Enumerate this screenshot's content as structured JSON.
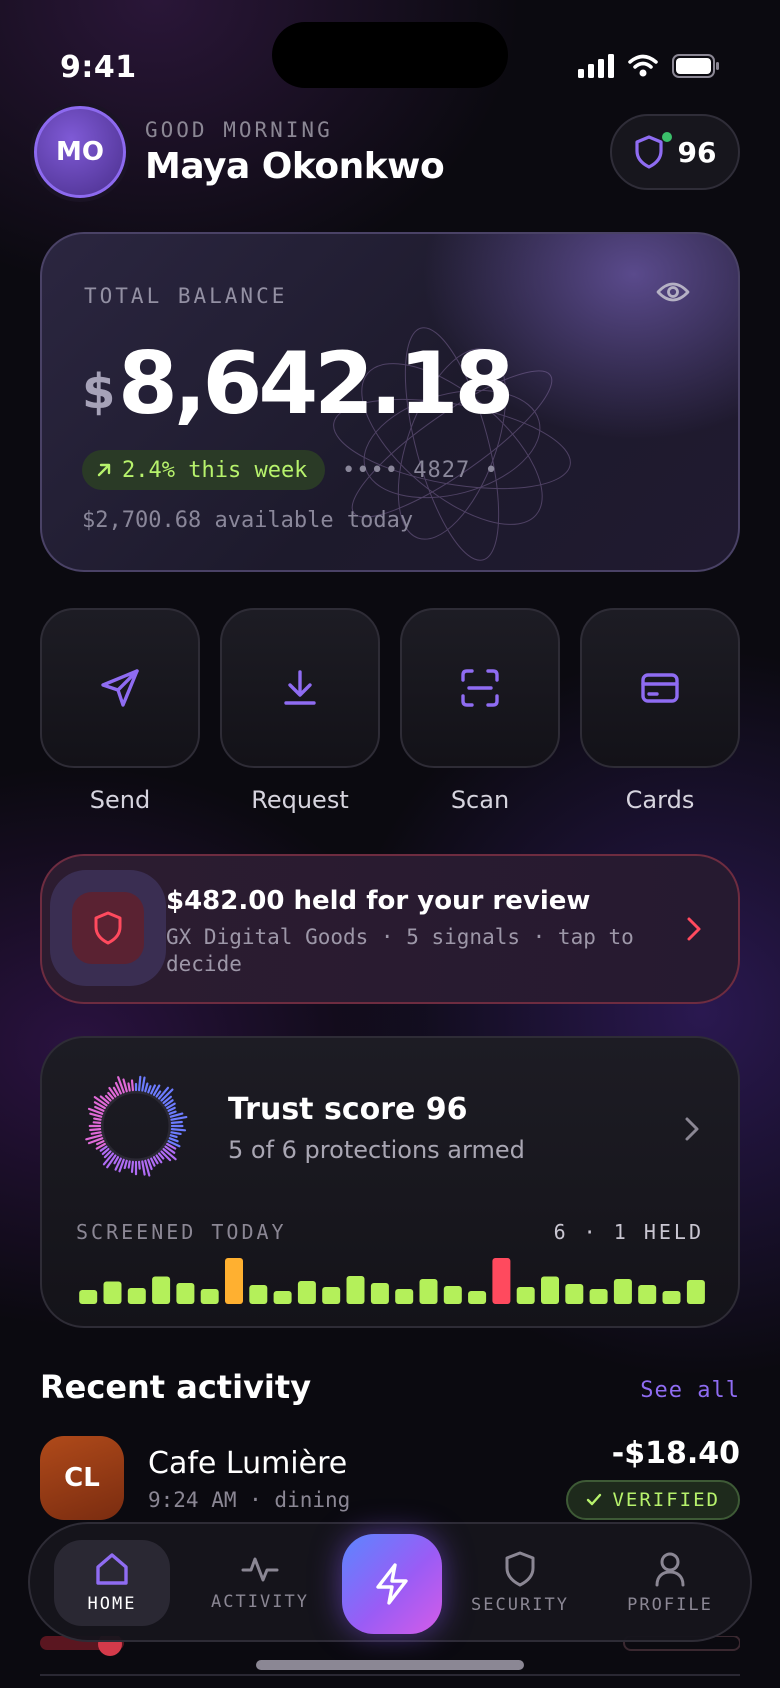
{
  "status": {
    "time": "9:41"
  },
  "header": {
    "avatar_initials": "MO",
    "greeting": "GOOD MORNING",
    "name": "Maya Okonkwo",
    "trust_badge_value": "96"
  },
  "balance": {
    "label": "TOTAL BALANCE",
    "currency": "$",
    "amount": "8,642.18",
    "trend": "2.4% this week",
    "card_mask": "•••• 4827 •",
    "available": "$2,700.68 available today"
  },
  "actions": [
    {
      "label": "Send",
      "icon": "send-icon"
    },
    {
      "label": "Request",
      "icon": "download-icon"
    },
    {
      "label": "Scan",
      "icon": "scan-icon"
    },
    {
      "label": "Cards",
      "icon": "card-icon"
    }
  ],
  "review": {
    "title": "$482.00 held for your review",
    "subtitle": "GX Digital Goods · 5 signals · tap to decide"
  },
  "trust": {
    "title": "Trust score 96",
    "subtitle": "5 of 6 protections armed",
    "screened_label": "SCREENED TODAY",
    "screened_count": "6 · 1 HELD",
    "bars": [
      {
        "level": 0.28,
        "status": "ok"
      },
      {
        "level": 0.45,
        "status": "ok"
      },
      {
        "level": 0.32,
        "status": "ok"
      },
      {
        "level": 0.55,
        "status": "ok"
      },
      {
        "level": 0.42,
        "status": "ok"
      },
      {
        "level": 0.3,
        "status": "ok"
      },
      {
        "level": 0.92,
        "status": "warn"
      },
      {
        "level": 0.38,
        "status": "ok"
      },
      {
        "level": 0.26,
        "status": "ok"
      },
      {
        "level": 0.46,
        "status": "ok"
      },
      {
        "level": 0.34,
        "status": "ok"
      },
      {
        "level": 0.56,
        "status": "ok"
      },
      {
        "level": 0.42,
        "status": "ok"
      },
      {
        "level": 0.3,
        "status": "ok"
      },
      {
        "level": 0.5,
        "status": "ok"
      },
      {
        "level": 0.36,
        "status": "ok"
      },
      {
        "level": 0.26,
        "status": "ok"
      },
      {
        "level": 0.92,
        "status": "held"
      },
      {
        "level": 0.34,
        "status": "ok"
      },
      {
        "level": 0.55,
        "status": "ok"
      },
      {
        "level": 0.4,
        "status": "ok"
      },
      {
        "level": 0.3,
        "status": "ok"
      },
      {
        "level": 0.5,
        "status": "ok"
      },
      {
        "level": 0.38,
        "status": "ok"
      },
      {
        "level": 0.26,
        "status": "ok"
      },
      {
        "level": 0.48,
        "status": "ok"
      }
    ],
    "colors": {
      "ok": "#b4f05a",
      "warn": "#ffb030",
      "held": "#ff4a5e"
    }
  },
  "recent": {
    "title": "Recent activity",
    "see_all": "See all",
    "transactions": [
      {
        "initials": "CL",
        "name": "Cafe Lumière",
        "meta": "9:24 AM · dining",
        "amount": "-$18.40",
        "status": "VERIFIED"
      }
    ]
  },
  "tabs": [
    {
      "label": "HOME",
      "icon": "home-icon",
      "active": true
    },
    {
      "label": "ACTIVITY",
      "icon": "activity-icon",
      "active": false
    },
    {
      "label": "SECURITY",
      "icon": "shield-icon",
      "active": false
    },
    {
      "label": "PROFILE",
      "icon": "user-icon",
      "active": false
    }
  ],
  "colors": {
    "accent": "#8f6cf2",
    "positive": "#b7f26c",
    "danger": "#ff4a5e"
  }
}
